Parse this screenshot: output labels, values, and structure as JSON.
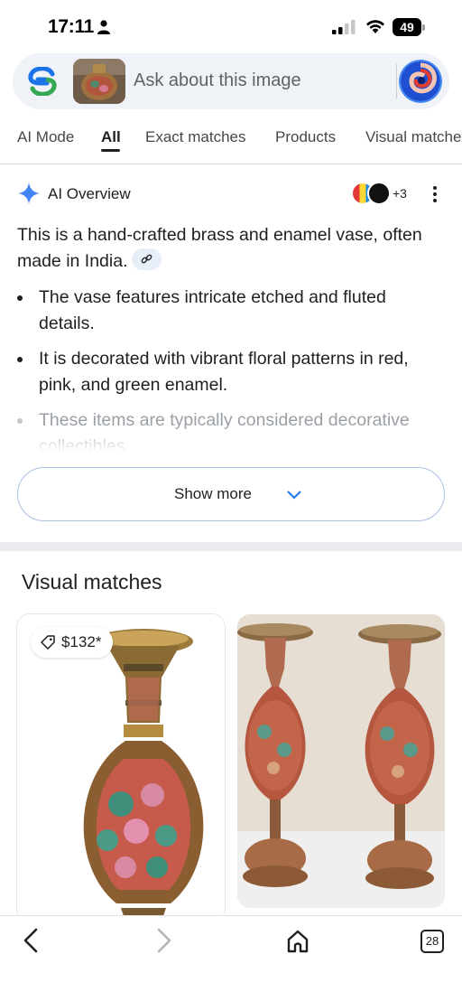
{
  "status_bar": {
    "time": "17:11",
    "battery": "49"
  },
  "search": {
    "placeholder": "Ask about this image"
  },
  "tabs": [
    {
      "label": "AI Mode"
    },
    {
      "label": "All"
    },
    {
      "label": "Exact matches"
    },
    {
      "label": "Products"
    },
    {
      "label": "Visual matches"
    }
  ],
  "ai_overview": {
    "title": "AI Overview",
    "source_extra": "+3",
    "summary": "This is a hand-crafted brass and enamel vase, often made in India.",
    "bullets": [
      "The vase features intricate etched and fluted details.",
      "It is decorated with vibrant floral patterns in red, pink, and green enamel.",
      "These items are typically considered decorative collectibles."
    ],
    "show_more": "Show more"
  },
  "visual_matches": {
    "title": "Visual matches",
    "items": [
      {
        "price": "$132*"
      },
      {
        "price": ""
      }
    ]
  },
  "bottom_nav": {
    "tab_count": "28"
  },
  "colors": {
    "accent_blue": "#4285f4",
    "searchbar_bg": "#eff3f8",
    "text_primary": "#1f1f1f",
    "text_faded": "#9aa0a6"
  }
}
